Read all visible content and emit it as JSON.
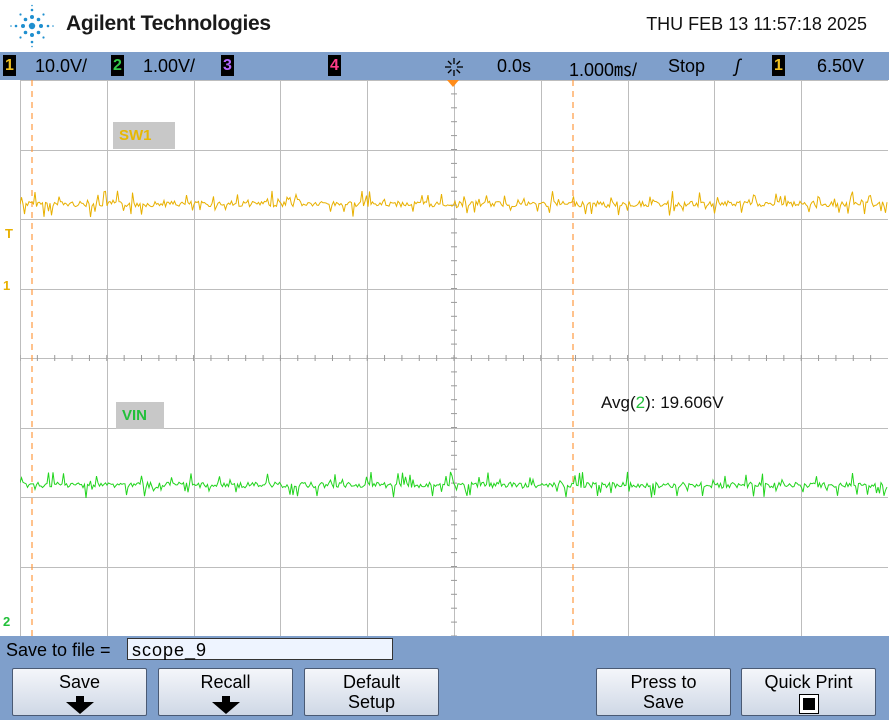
{
  "header": {
    "brand": "Agilent Technologies",
    "datetime": "THU FEB 13 11:57:18 2025"
  },
  "statusbar": {
    "ch1_num": "1",
    "ch1_scale": "10.0V/",
    "ch2_num": "2",
    "ch2_scale": "1.00V/",
    "ch3_num": "3",
    "ch4_num": "4",
    "time_delay": "0.0s",
    "time_scale": "1.000㎳/",
    "run_state": "Stop",
    "trigger_slope": "ʃ",
    "trigger_source": "1",
    "trigger_level": "6.50V"
  },
  "traces": {
    "sw1_label": "SW1",
    "vin_label": "VIN",
    "sw1_color": "#e8b000",
    "vin_color": "#22d41e"
  },
  "markers": {
    "trigger_marker": "T",
    "ch1_marker": "1",
    "ch2_marker": "2"
  },
  "measurement": {
    "prefix": "Avg(",
    "channel": "2",
    "suffix": "): 19.606V"
  },
  "softkeys": {
    "save_to_file_label": "Save to file =",
    "filename": "scope_9",
    "save": "Save",
    "recall": "Recall",
    "default_l1": "Default",
    "default_l2": "Setup",
    "press_l1": "Press to",
    "press_l2": "Save",
    "quick_print": "Quick Print"
  }
}
